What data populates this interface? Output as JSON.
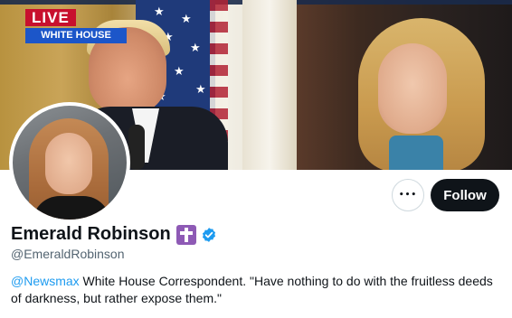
{
  "banner": {
    "live_label": "LIVE",
    "location_label": "WHITE HOUSE"
  },
  "profile": {
    "name": "Emerald Robinson",
    "handle": "@EmeraldRobinson",
    "bio": {
      "mention": "@Newsmax",
      "text": " White House Correspondent. \"Have nothing to do with the fruitless deeds of darkness, but rather expose them.\""
    },
    "badges": [
      "cross-emoji",
      "verified-badge"
    ]
  },
  "actions": {
    "more_label": "•••",
    "follow_label": "Follow"
  },
  "colors": {
    "live_red": "#c8102e",
    "location_blue": "#1c56c9",
    "follow_bg": "#0f1419",
    "mention_blue": "#1d9bf0",
    "verified_blue": "#1d9bf0",
    "cross_purple": "#8e5ab5",
    "handle_gray": "#536471"
  }
}
